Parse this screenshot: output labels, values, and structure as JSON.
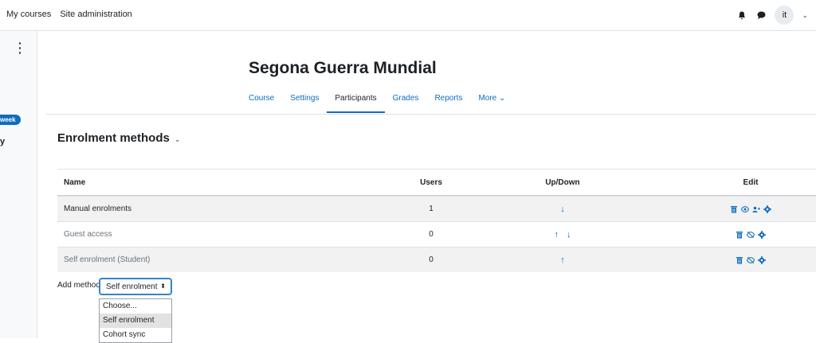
{
  "nav": {
    "my_courses": "My courses",
    "site_admin": "Site administration",
    "avatar_initials": "it"
  },
  "drawer": {
    "pill_label": "week",
    "side_letter": "y"
  },
  "course": {
    "title": "Segona Guerra Mundial"
  },
  "tabs": [
    {
      "label": "Course"
    },
    {
      "label": "Settings"
    },
    {
      "label": "Participants"
    },
    {
      "label": "Grades"
    },
    {
      "label": "Reports"
    },
    {
      "label": "More ⌄"
    }
  ],
  "page": {
    "heading": "Enrolment methods"
  },
  "table": {
    "headers": {
      "name": "Name",
      "users": "Users",
      "updown": "Up/Down",
      "edit": "Edit"
    },
    "rows": [
      {
        "name": "Manual enrolments",
        "users": "1",
        "up": false,
        "down": true
      },
      {
        "name": "Guest access",
        "users": "0",
        "up": true,
        "down": true
      },
      {
        "name": "Self enrolment (Student)",
        "users": "0",
        "up": true,
        "down": false
      }
    ]
  },
  "add_method": {
    "label": "Add method",
    "selected": "Self enrolment",
    "options": [
      "Choose...",
      "Self enrolment",
      "Cohort sync"
    ]
  },
  "colors": {
    "accent": "#0f6cbf",
    "focus_ring": "#3584c8"
  }
}
